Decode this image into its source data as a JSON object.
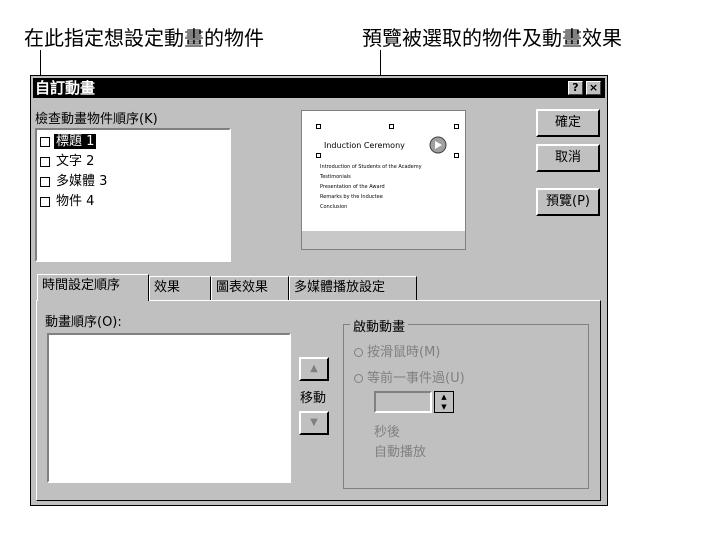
{
  "callouts": {
    "left": "在此指定想設定動畫的物件",
    "right": "預覽被選取的物件及動畫效果"
  },
  "dialog": {
    "title": "自訂動畫",
    "help_button": "?",
    "close_button": "×",
    "objects_label": "檢查動畫物件順序(K)",
    "objects": [
      {
        "label": "標題 1",
        "checked": false,
        "selected": true
      },
      {
        "label": "文字 2",
        "checked": false,
        "selected": false
      },
      {
        "label": "多媒體 3",
        "checked": false,
        "selected": false
      },
      {
        "label": "物件 4",
        "checked": false,
        "selected": false
      }
    ],
    "buttons": {
      "ok": "確定",
      "cancel": "取消",
      "preview": "預覽(P)"
    },
    "preview": {
      "slide_title": "Induction Ceremony",
      "bullets": [
        "Introduction of Students of the Academy",
        "Testimonials",
        "Presentation of the Award",
        "Remarks by the Inductee",
        "Conclusion"
      ]
    },
    "tabs": [
      "時間設定順序",
      "效果",
      "圖表效果",
      "多媒體播放設定"
    ],
    "active_tab": 0,
    "timing": {
      "order_label": "動畫順序(O):",
      "move_label": "移動",
      "start_group_label": "啟動動畫",
      "on_click_label": "按滑鼠時(M)",
      "after_label": "等前一事件過(U)",
      "seconds_suffix": "秒後",
      "auto_play": "自動播放",
      "seconds_value": ""
    }
  }
}
